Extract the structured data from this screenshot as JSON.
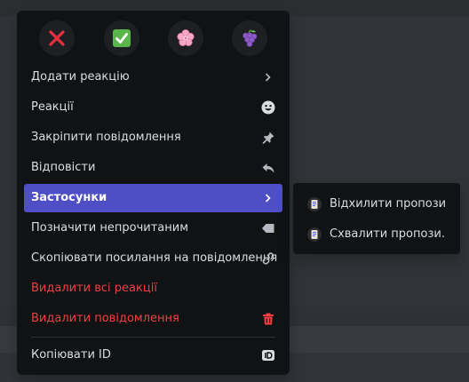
{
  "reactions": [
    {
      "name": "cross-mark",
      "glyph": "❌"
    },
    {
      "name": "check-mark",
      "glyph": "✅"
    },
    {
      "name": "cherry-blossom",
      "glyph": "🌸"
    },
    {
      "name": "grapes",
      "glyph": "🍇"
    }
  ],
  "menu": {
    "items": [
      {
        "label": "Додати реакцію",
        "icon": "chevron-right-icon"
      },
      {
        "label": "Реакції",
        "icon": "smiley-icon"
      },
      {
        "label": "Закріпити повідомлення",
        "icon": "pin-icon"
      },
      {
        "label": "Відповісти",
        "icon": "reply-icon"
      },
      {
        "label": "Застосунки",
        "icon": "chevron-right-icon",
        "state": "active"
      },
      {
        "label": "Позначити непрочитаним",
        "icon": "unread-tag-icon"
      },
      {
        "label": "Скопіювати посилання на повідомлення",
        "icon": "link-icon"
      },
      {
        "label": "Видалити всі реакції",
        "icon": "",
        "style": "danger"
      },
      {
        "label": "Видалити повідомлення",
        "icon": "trash-icon",
        "style": "danger"
      },
      {
        "label": "Копіювати ID",
        "icon": "id-icon"
      }
    ]
  },
  "submenu": {
    "items": [
      {
        "label": "Відхилити пропози...",
        "icon": "app-icon"
      },
      {
        "label": "Схвалити пропози...",
        "icon": "app-icon"
      }
    ]
  },
  "colors": {
    "menu_bg": "#111214",
    "active_bg": "#4e4fc4",
    "text": "#dbdee1",
    "danger": "#f23f43"
  }
}
